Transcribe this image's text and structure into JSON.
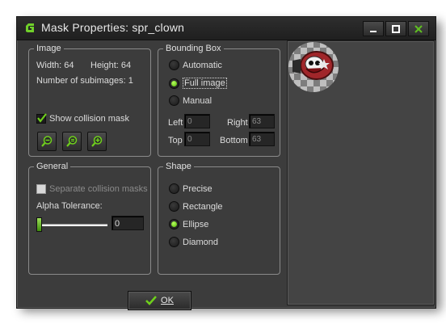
{
  "window": {
    "title": "Mask Properties: spr_clown"
  },
  "image": {
    "legend": "Image",
    "width_label": "Width: 64",
    "height_label": "Height: 64",
    "subimages_label": "Number of subimages: 1",
    "show_collision_mask": {
      "label": "Show collision mask",
      "checked": true
    }
  },
  "bounding_box": {
    "legend": "Bounding Box",
    "options": [
      {
        "label": "Automatic",
        "selected": false
      },
      {
        "label": "Full image",
        "selected": true
      },
      {
        "label": "Manual",
        "selected": false
      }
    ],
    "left": {
      "label": "Left",
      "value": "0"
    },
    "right": {
      "label": "Right",
      "value": "63"
    },
    "top": {
      "label": "Top",
      "value": "0"
    },
    "bottom": {
      "label": "Bottom",
      "value": "63"
    }
  },
  "general": {
    "legend": "General",
    "separate_masks": {
      "label": "Separate collision masks",
      "checked": false,
      "enabled": false
    },
    "alpha_label": "Alpha Tolerance:",
    "alpha_value": "0",
    "alpha_fraction": 0
  },
  "shape": {
    "legend": "Shape",
    "options": [
      {
        "label": "Precise",
        "selected": false
      },
      {
        "label": "Rectangle",
        "selected": false
      },
      {
        "label": "Ellipse",
        "selected": true
      },
      {
        "label": "Diamond",
        "selected": false
      }
    ]
  },
  "ok_button": {
    "label": "OK"
  },
  "colors": {
    "accent_green": "#6fd01c",
    "window_bg": "#3c3c3c",
    "titlebar_bg": "#222222"
  },
  "icons": [
    "gamemaker-logo-icon",
    "minimize-icon",
    "maximize-icon",
    "close-icon",
    "zoom-out-icon",
    "zoom-reset-icon",
    "zoom-in-icon",
    "checkmark-icon"
  ]
}
